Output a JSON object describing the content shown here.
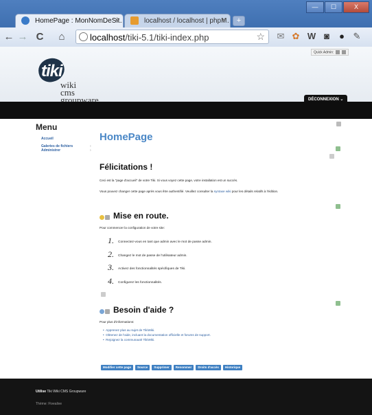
{
  "browser": {
    "tabs": [
      {
        "title": "HomePage : MonNomDeSit…",
        "close": "×"
      },
      {
        "title": "localhost / localhost | phpM…",
        "close": "×"
      }
    ],
    "new_tab": "+",
    "window_buttons": [
      "—",
      "☐",
      "X"
    ],
    "url_host": "localhost",
    "url_path": "/tiki-5.1/tiki-index.php",
    "nav": {
      "back": "←",
      "forward": "→",
      "reload": "C",
      "home": "⌂"
    }
  },
  "site": {
    "logo_mark": "tiki",
    "logo_lines": [
      "wiki",
      "cms",
      "groupware"
    ],
    "quick_admin": "Quick Admin:",
    "logout_label": "DÉCONNEXION"
  },
  "menu": {
    "title": "Menu",
    "items": [
      {
        "label": "Accueil"
      },
      {
        "label": "Galeries de fichiers"
      },
      {
        "label": "Administrer"
      }
    ]
  },
  "content": {
    "page_title": "HomePage",
    "congrats_heading": "Félicitations !",
    "para1": "Ceci est la \"page d'accueil\" de votre Tiki. Si vous voyez cette page, votre installation est un succès.",
    "para2_before": "Vous pouvez changer cette page après vous être authentifié. Veuillez consulter la",
    "para2_link": "syntaxe wiki",
    "para2_after": "pour les détails relatifs à l'édition.",
    "start_heading": "Mise en route.",
    "start_intro": "Pour commencer la configuration de votre site:",
    "steps": [
      {
        "num": "1.",
        "text": "Connectez-vous en tant que admin avec le mot de passe admin."
      },
      {
        "num": "2.",
        "text": "Changez le mot de passe de l'utilisateur admin."
      },
      {
        "num": "3.",
        "text": "Activez des fonctionnalités spécifiques de Tiki."
      },
      {
        "num": "4.",
        "text": "Configurez les fonctionnalités."
      }
    ],
    "help_heading": "Besoin d'aide ?",
    "help_intro": "Pour plus d'informations:",
    "help_links": [
      "Apprenez plus au sujet de TikiWiki.",
      "Obtenez de l'aide, incluant la documentation officielle et forums de support.",
      "Rejoignez la communauté TikiWiki."
    ],
    "actions": [
      "Modifier cette page",
      "Source",
      "Supprimer",
      "Renommer",
      "Droits d'accès",
      "Historique"
    ]
  },
  "footer": {
    "powered_label": "Utilise",
    "powered_text": "Tiki Wiki CMS Groupware",
    "theme": "Thème: Fivealive"
  }
}
